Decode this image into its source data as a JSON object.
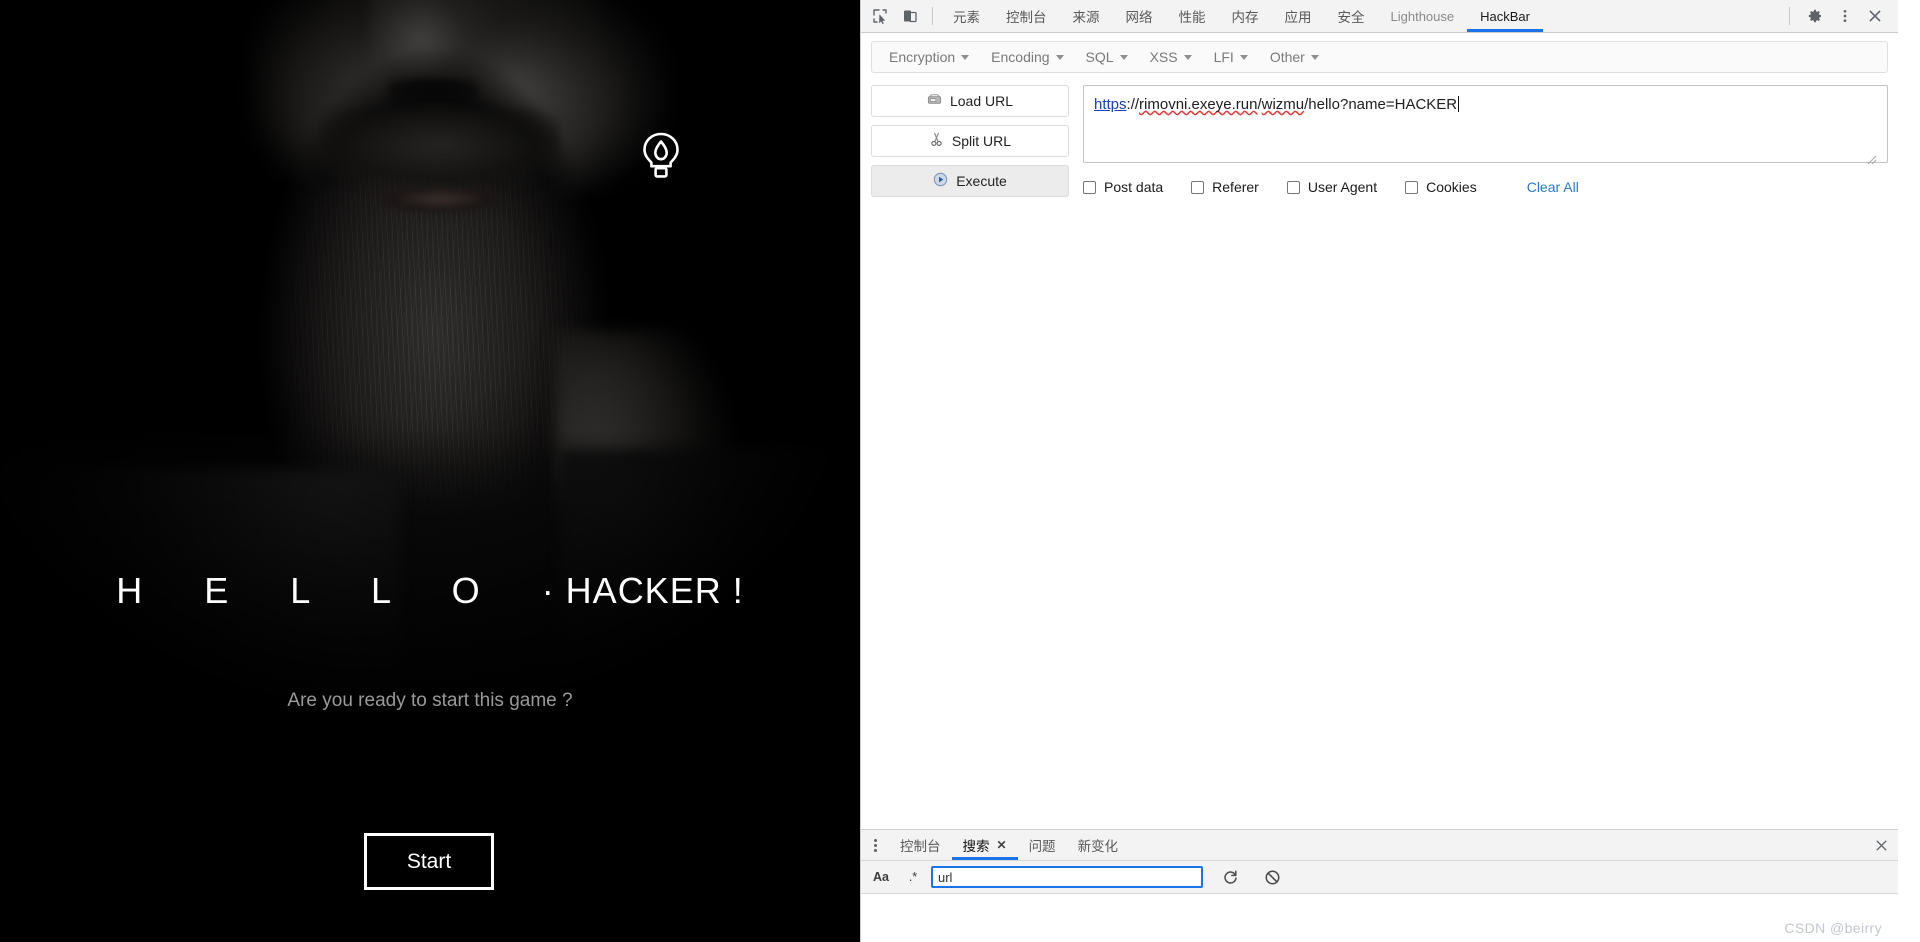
{
  "webpage": {
    "hero_icon": "lightbulb-flame-icon",
    "title_spaced": "H E L L O ",
    "title_rest": "· HACKER !",
    "title_full": "H E L L O · HACKER !",
    "subtitle": "Are you ready to start this game ?",
    "start_button": "Start"
  },
  "devtools": {
    "toolbar": {
      "inspect_icon": "inspect-element-icon",
      "device_icon": "device-toolbar-icon",
      "tabs": [
        {
          "label": "元素",
          "active": false,
          "latin": false
        },
        {
          "label": "控制台",
          "active": false,
          "latin": false
        },
        {
          "label": "来源",
          "active": false,
          "latin": false
        },
        {
          "label": "网络",
          "active": false,
          "latin": false
        },
        {
          "label": "性能",
          "active": false,
          "latin": false
        },
        {
          "label": "内存",
          "active": false,
          "latin": false
        },
        {
          "label": "应用",
          "active": false,
          "latin": false
        },
        {
          "label": "安全",
          "active": false,
          "latin": false
        },
        {
          "label": "Lighthouse",
          "active": false,
          "latin": true
        },
        {
          "label": "HackBar",
          "active": true,
          "latin": true
        }
      ],
      "settings_icon": "gear-icon",
      "more_icon": "kebab-menu-icon",
      "close_icon": "close-icon",
      "accent": "#1a73e8"
    },
    "hackbar": {
      "menus": [
        {
          "label": "Encryption"
        },
        {
          "label": "Encoding"
        },
        {
          "label": "SQL"
        },
        {
          "label": "XSS"
        },
        {
          "label": "LFI"
        },
        {
          "label": "Other"
        }
      ],
      "buttons": [
        {
          "label": "Load URL",
          "icon": "load-url-icon",
          "primary": false
        },
        {
          "label": "Split URL",
          "icon": "scissors-icon",
          "primary": false
        },
        {
          "label": "Execute",
          "icon": "play-icon",
          "primary": true
        }
      ],
      "url": {
        "value": "https://rimovni.exeye.run/wizmu/hello?name=HACKER",
        "protocol": "https",
        "rest": "://rimovni.exeye.run/wizmu/hello?name=HACKER",
        "part_sep1": "://",
        "part_host1": "rimovni.exeye.run",
        "part_slash1": "/",
        "part_path1": "wizmu",
        "part_tail": "/hello?name=HACKER"
      },
      "checkboxes": [
        {
          "label": "Post data",
          "checked": false
        },
        {
          "label": "Referer",
          "checked": false
        },
        {
          "label": "User Agent",
          "checked": false
        },
        {
          "label": "Cookies",
          "checked": false
        }
      ],
      "clear_all": "Clear All",
      "clear_all_color": "#2879d0"
    },
    "drawer": {
      "menu_icon": "kebab-menu-icon",
      "tabs": [
        {
          "label": "控制台",
          "active": false,
          "closable": false
        },
        {
          "label": "搜索",
          "active": true,
          "closable": true,
          "close_glyph": "✕"
        },
        {
          "label": "问题",
          "active": false,
          "closable": false
        },
        {
          "label": "新变化",
          "active": false,
          "closable": false
        }
      ],
      "close_icon": "close-icon",
      "search": {
        "match_case_label": "Aa",
        "regex_label": ".*",
        "value": "url",
        "placeholder": "",
        "refresh_icon": "refresh-icon",
        "clear_icon": "clear-results-icon"
      }
    }
  },
  "watermark": "CSDN @beirry"
}
